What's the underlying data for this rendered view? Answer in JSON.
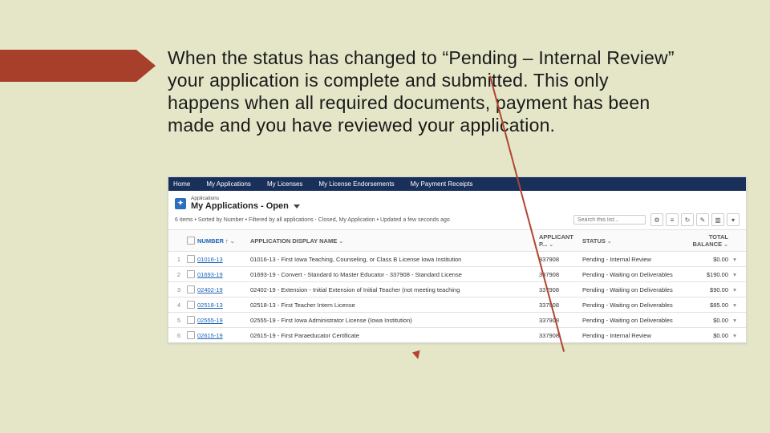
{
  "body_text": "When the status has changed to “Pending – Internal Review” your application is complete and submitted. This only happens when all required documents, payment has been made and you have reviewed your application.",
  "nav": {
    "items": [
      "Home",
      "My Applications",
      "My Licenses",
      "My License Endorsements",
      "My Payment Receipts"
    ]
  },
  "header": {
    "small": "Applications",
    "title": "My Applications - Open",
    "filter": "6 items • Sorted by Number • Filtered by all applications - Closed, My Application • Updated a few seconds ago",
    "search_placeholder": "Search this list..."
  },
  "tool_icons": [
    "gear-icon",
    "list-icon",
    "refresh-icon",
    "edit-icon",
    "chart-icon",
    "filter-icon"
  ],
  "columns": {
    "number": "NUMBER ↑",
    "name": "APPLICATION DISPLAY NAME",
    "applicant": "APPLICANT P...",
    "status": "STATUS",
    "balance": "TOTAL BALANCE"
  },
  "rows": [
    {
      "idx": "1",
      "num": "01016-13",
      "name": "01016-13 - First Iowa Teaching, Counseling, or Class B License Iowa Institution",
      "applicant": "337908",
      "status": "Pending - Internal Review",
      "balance": "$0.00"
    },
    {
      "idx": "2",
      "num": "01693-19",
      "name": "01693-19 - Convert - Standard to Master Educator - 337908 - Standard License",
      "applicant": "337908",
      "status": "Pending - Waiting on Deliverables",
      "balance": "$190.00"
    },
    {
      "idx": "3",
      "num": "02402-19",
      "name": "02402-19 - Extension - Initial Extension of Initial Teacher (not meeting teaching",
      "applicant": "337908",
      "status": "Pending - Waiting on Deliverables",
      "balance": "$90.00"
    },
    {
      "idx": "4",
      "num": "02518-13",
      "name": "02518-13 - First Teacher Intern License",
      "applicant": "337908",
      "status": "Pending - Waiting on Deliverables",
      "balance": "$85.00"
    },
    {
      "idx": "5",
      "num": "02555-19",
      "name": "02555-19 - First Iowa Administrator License (Iowa Institution)",
      "applicant": "337908",
      "status": "Pending - Waiting on Deliverables",
      "balance": "$0.00"
    },
    {
      "idx": "6",
      "num": "02615-19",
      "name": "02615-19 - First Paraeducator Certificate",
      "applicant": "337908",
      "status": "Pending - Internal Review",
      "balance": "$0.00"
    }
  ]
}
